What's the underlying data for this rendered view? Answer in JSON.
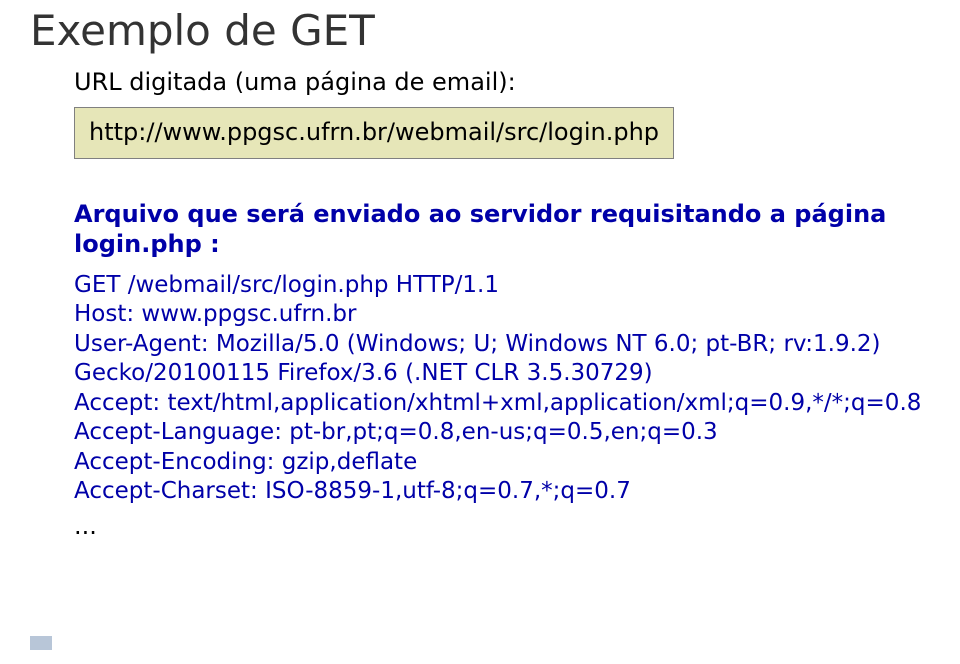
{
  "title": "Exemplo de GET",
  "subhead": "URL digitada (uma página de email):",
  "url": "http://www.ppgsc.ufrn.br/webmail/src/login.php",
  "req_intro": "Arquivo que será enviado ao servidor requisitando a página login.php :",
  "req_lines": [
    "GET /webmail/src/login.php HTTP/1.1",
    "Host: www.ppgsc.ufrn.br",
    "User-Agent: Mozilla/5.0 (Windows; U; Windows NT 6.0; pt-BR; rv:1.9.2) Gecko/20100115 Firefox/3.6 (.NET CLR 3.5.30729)",
    "Accept: text/html,application/xhtml+xml,application/xml;q=0.9,*/*;q=0.8",
    "Accept-Language: pt-br,pt;q=0.8,en-us;q=0.5,en;q=0.3",
    "Accept-Encoding: gzip,deflate",
    "Accept-Charset: ISO-8859-1,utf-8;q=0.7,*;q=0.7"
  ],
  "ellipsis": "..."
}
